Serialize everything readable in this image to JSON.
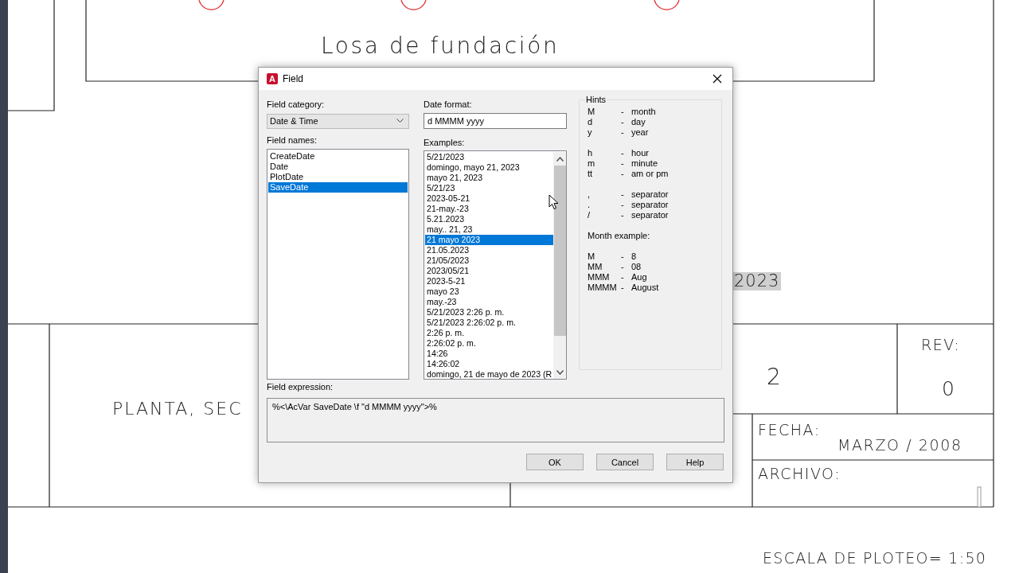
{
  "drawing": {
    "texts": [
      {
        "kind": "title",
        "text": "Losa de fundación"
      },
      {
        "kind": "plan",
        "text": "PLANTA, SEC"
      },
      {
        "kind": "field",
        "text": "2023"
      },
      {
        "kind": "sheet",
        "text": "2"
      },
      {
        "kind": "rev_label",
        "text": "REV:"
      },
      {
        "kind": "rev_value",
        "text": "0"
      },
      {
        "kind": "date_label",
        "text": "FECHA:"
      },
      {
        "kind": "date_value",
        "text": "MARZO / 2008"
      },
      {
        "kind": "file_label",
        "text": "ARCHIVO:"
      },
      {
        "kind": "scale",
        "text": "ESCALA DE PLOTEO= 1:50"
      }
    ]
  },
  "dialog": {
    "app_icon_letter": "A",
    "title": "Field",
    "field_category": {
      "label": "Field category:",
      "value": "Date & Time"
    },
    "field_names": {
      "label": "Field names:",
      "items": [
        {
          "text": "CreateDate",
          "selected": false
        },
        {
          "text": "Date",
          "selected": false
        },
        {
          "text": "PlotDate",
          "selected": false
        },
        {
          "text": "SaveDate",
          "selected": true
        }
      ]
    },
    "date_format": {
      "label": "Date format:",
      "value": "d MMMM yyyy"
    },
    "examples": {
      "label": "Examples:",
      "items": [
        {
          "text": "5/21/2023",
          "selected": false
        },
        {
          "text": "domingo, mayo 21, 2023",
          "selected": false
        },
        {
          "text": "mayo 21, 2023",
          "selected": false
        },
        {
          "text": "5/21/23",
          "selected": false
        },
        {
          "text": "2023-05-21",
          "selected": false
        },
        {
          "text": "21-may.-23",
          "selected": false
        },
        {
          "text": "5.21.2023",
          "selected": false
        },
        {
          "text": "may.. 21, 23",
          "selected": false
        },
        {
          "text": "21 mayo 2023",
          "selected": true
        },
        {
          "text": "21.05.2023",
          "selected": false
        },
        {
          "text": "21/05/2023",
          "selected": false
        },
        {
          "text": "2023/05/21",
          "selected": false
        },
        {
          "text": "2023-5-21",
          "selected": false
        },
        {
          "text": "mayo 23",
          "selected": false
        },
        {
          "text": "may.-23",
          "selected": false
        },
        {
          "text": "5/21/2023 2:26 p. m.",
          "selected": false
        },
        {
          "text": "5/21/2023 2:26:02 p. m.",
          "selected": false
        },
        {
          "text": "2:26 p. m.",
          "selected": false
        },
        {
          "text": "2:26:02 p. m.",
          "selected": false
        },
        {
          "text": "14:26",
          "selected": false
        },
        {
          "text": "14:26:02",
          "selected": false
        },
        {
          "text": "domingo, 21 de mayo de 2023 (R",
          "selected": false
        }
      ]
    },
    "hints": {
      "title": "Hints",
      "groups": [
        [
          {
            "key": "M",
            "sep": "-",
            "desc": "month"
          },
          {
            "key": "d",
            "sep": "-",
            "desc": "day"
          },
          {
            "key": "y",
            "sep": "-",
            "desc": "year"
          }
        ],
        [
          {
            "key": "h",
            "sep": "-",
            "desc": "hour"
          },
          {
            "key": "m",
            "sep": "-",
            "desc": "minute"
          },
          {
            "key": "tt",
            "sep": "-",
            "desc": "am or pm"
          }
        ],
        [
          {
            "key": ",",
            "sep": "-",
            "desc": "separator"
          },
          {
            "key": ".",
            "sep": "-",
            "desc": "separator"
          },
          {
            "key": "/",
            "sep": "-",
            "desc": "separator"
          }
        ]
      ],
      "month_title": "Month example:",
      "month_rows": [
        {
          "key": "M",
          "sep": "-",
          "desc": "8"
        },
        {
          "key": "MM",
          "sep": "-",
          "desc": "08"
        },
        {
          "key": "MMM",
          "sep": "-",
          "desc": "Aug"
        },
        {
          "key": "MMMM",
          "sep": "-",
          "desc": "August"
        }
      ]
    },
    "field_expression": {
      "label": "Field expression:",
      "value": "%<\\AcVar SaveDate \\f \"d MMMM yyyy\">%"
    },
    "buttons": [
      {
        "label": "OK"
      },
      {
        "label": "Cancel"
      },
      {
        "label": "Help"
      }
    ]
  }
}
